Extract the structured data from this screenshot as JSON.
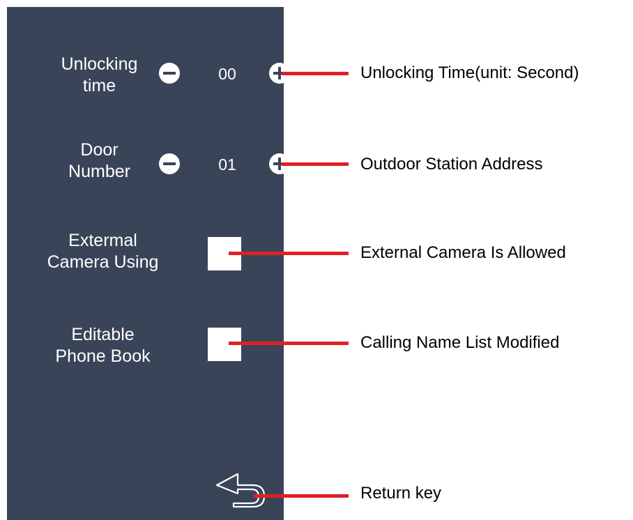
{
  "settings": {
    "unlocking_time": {
      "label": "Unlocking\ntime",
      "value": "00"
    },
    "door_number": {
      "label": "Door\nNumber",
      "value": "01"
    },
    "external_camera": {
      "label": "Extermal\nCamera Using",
      "checked": false
    },
    "phone_book": {
      "label": "Editable\nPhone Book",
      "checked": false
    }
  },
  "annotations": {
    "unlocking_time": "Unlocking Time(unit: Second)",
    "door_number": "Outdoor Station Address",
    "external_camera": "External Camera Is Allowed",
    "phone_book": "Calling Name List Modified",
    "return_key": "Return key"
  },
  "icons": {
    "decrement": "minus-circle-icon",
    "increment": "plus-circle-icon",
    "return": "return-arrow-icon"
  },
  "colors": {
    "panel": "#3a4458",
    "leader_line": "#e02025",
    "control": "#ffffff"
  }
}
